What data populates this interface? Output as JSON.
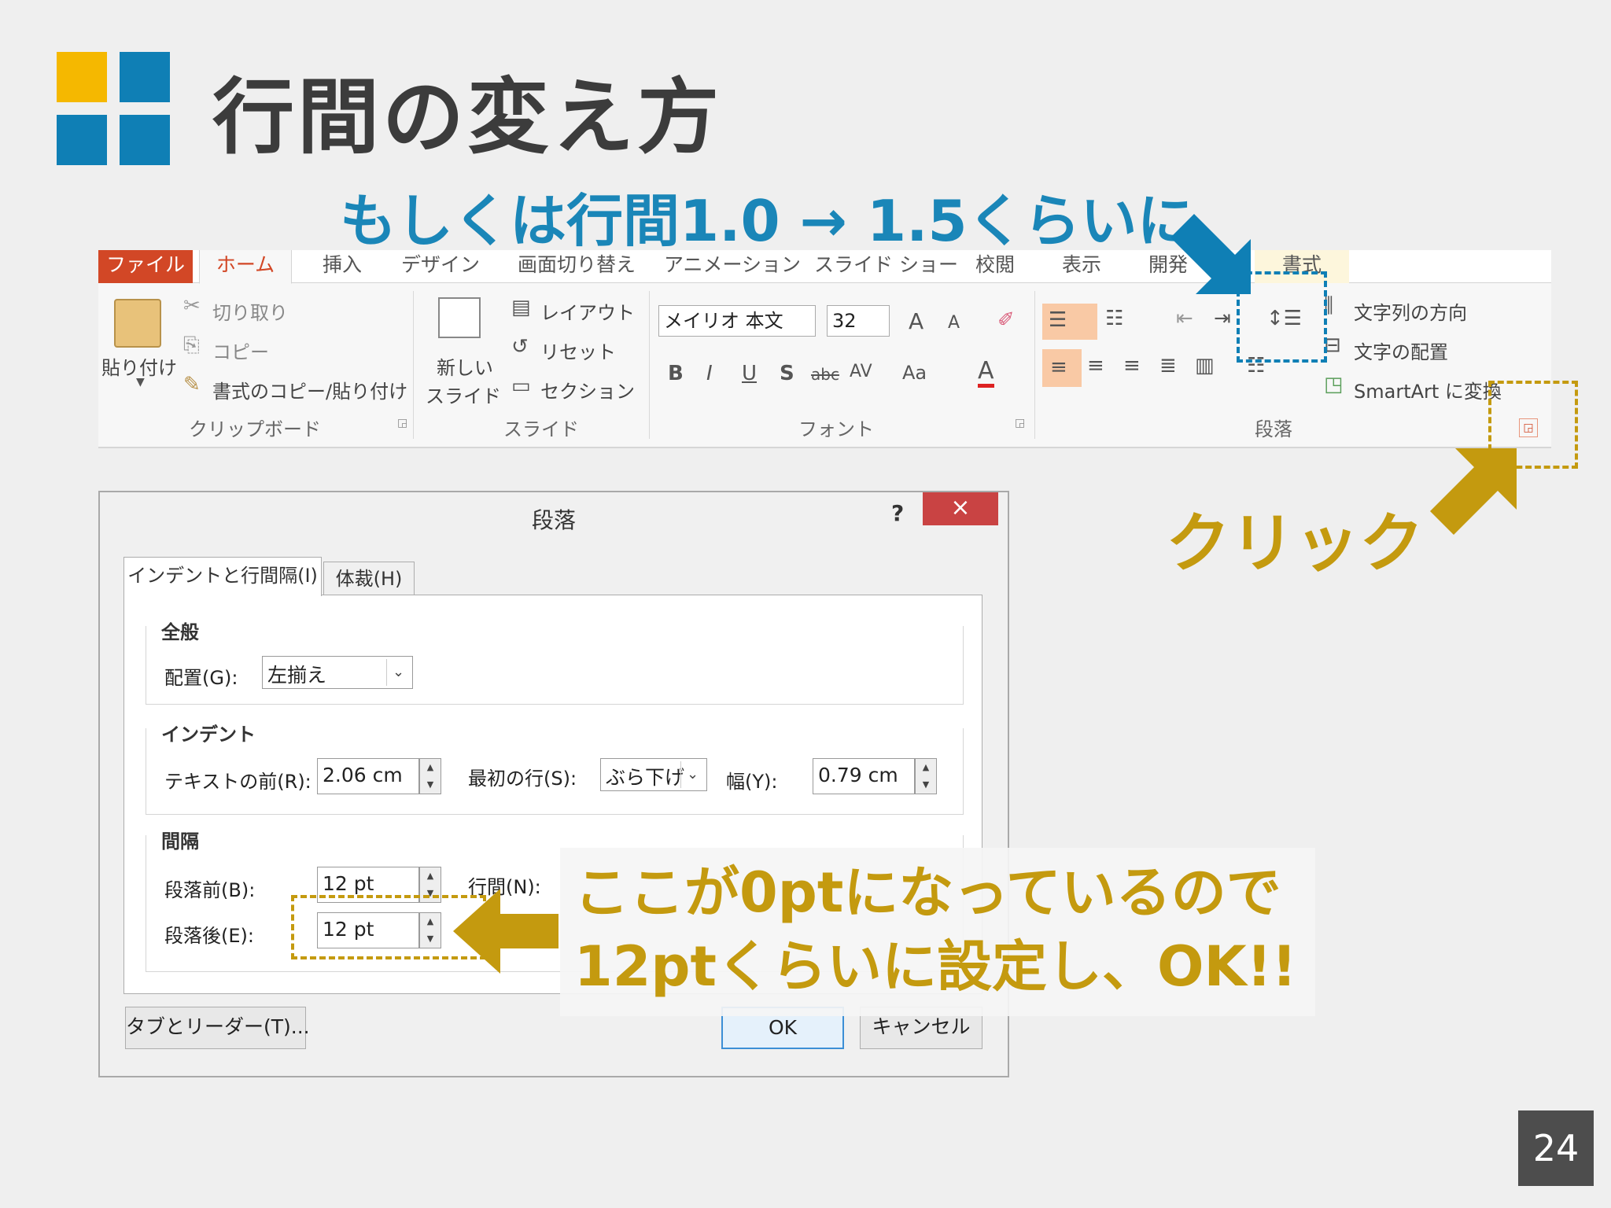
{
  "slide": {
    "title": "行間の変え方",
    "subtitle": "もしくは行間1.0 → 1.5くらいに",
    "click_label": "クリック",
    "callout_line1": "ここが0ptになっているので",
    "callout_line2": "12ptくらいに設定し、OK!!",
    "page_number": "24"
  },
  "colors": {
    "logo_yellow": "#f5b800",
    "logo_blue": "#0f7fb5",
    "accent_blue": "#1a86b8",
    "accent_gold": "#c49a0f",
    "file_tab": "#d24726"
  },
  "ribbon": {
    "tabs": [
      "ファイル",
      "ホーム",
      "挿入",
      "デザイン",
      "画面切り替え",
      "アニメーション",
      "スライド ショー",
      "校閲",
      "表示",
      "開発",
      "書式"
    ],
    "clipboard": {
      "paste": "貼り付け",
      "cut": "切り取り",
      "copy": "コピー",
      "format_painter": "書式のコピー/貼り付け",
      "label": "クリップボード"
    },
    "slides": {
      "new_slide_1": "新しい",
      "new_slide_2": "スライド",
      "layout": "レイアウト",
      "reset": "リセット",
      "section": "セクション",
      "label": "スライド"
    },
    "font": {
      "name": "メイリオ 本文",
      "size": "32",
      "grow": "A",
      "shrink": "A",
      "bold": "B",
      "italic": "I",
      "underline": "U",
      "shadow": "S",
      "strike": "abc",
      "spacing": "AV",
      "case": "Aa",
      "color": "A",
      "label": "フォント"
    },
    "paragraph": {
      "text_direction": "文字列の方向",
      "align_text": "文字の配置",
      "smartart": "SmartArt に変換",
      "label": "段落"
    }
  },
  "dialog": {
    "title": "段落",
    "help": "?",
    "close": "×",
    "tab_indent": "インデントと行間隔(I)",
    "tab_typography": "体裁(H)",
    "general": {
      "label": "全般",
      "alignment_label": "配置(G):",
      "alignment_value": "左揃え"
    },
    "indent": {
      "label": "インデント",
      "before_text_label": "テキストの前(R):",
      "before_text_value": "2.06 cm",
      "special_label": "最初の行(S):",
      "special_value": "ぶら下げ",
      "by_label": "幅(Y):",
      "by_value": "0.79 cm"
    },
    "spacing": {
      "label": "間隔",
      "before_label": "段落前(B):",
      "before_value": "12 pt",
      "line_label": "行間(N):",
      "after_label": "段落後(E):",
      "after_value": "12 pt"
    },
    "tabs_button": "タブとリーダー(T)...",
    "ok_button": "OK",
    "cancel_button": "キャンセル"
  }
}
